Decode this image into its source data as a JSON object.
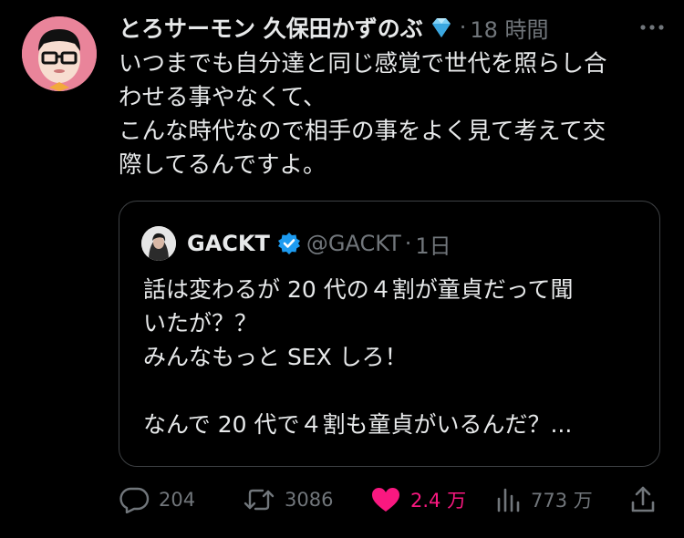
{
  "tweet": {
    "display_name": "とろサーモン 久保田かずのぶ",
    "badge_icon": "gem-icon",
    "separator": "·",
    "time": "18 時間",
    "lines": [
      "いつまでも自分達と同じ感覚で世代を照らし合",
      "わせる事やなくて、",
      "こんな時代なので相手の事をよく見て考えて交",
      "際してるんですよ。"
    ]
  },
  "quote": {
    "name": "GACKT",
    "handle": "@GACKT",
    "separator": "·",
    "time": "1日",
    "lines": [
      "話は変わるが 20 代の４割が童貞だって聞",
      "いたが？？",
      "みんなもっと SEX しろ！",
      "",
      "なんで 20 代で４割も童貞がいるんだ？..."
    ]
  },
  "actions": {
    "reply_count": "204",
    "retweet_count": "3086",
    "like_count": "2.4 万",
    "view_count": "773 万"
  },
  "colors": {
    "background": "#000000",
    "text": "#e7e9ea",
    "secondary": "#71767b",
    "like": "#f91880",
    "verified": "#1d9bf0",
    "border": "#3e4144"
  }
}
